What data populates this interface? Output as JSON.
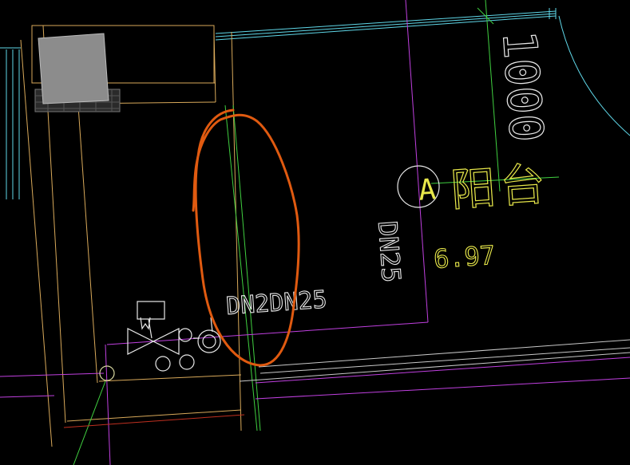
{
  "drawing": {
    "dimension_label": "1000",
    "room_label": "阳台",
    "grid_marker": "A",
    "elevation": "6.97",
    "pipe_label_vertical": "DN25",
    "pipe_label_horizontal": "DN2DN25"
  },
  "colors": {
    "background": "#000000",
    "wall_outline": "#d8a95a",
    "wall_cyan": "#5fd7e8",
    "pipe_magenta": "#c040e0",
    "axis_green": "#40d040",
    "markup_orange": "#e05a10",
    "text_white": "#e8e8e8",
    "text_yellow": "#e8e84a",
    "column_fill": "#8c8c8c"
  }
}
